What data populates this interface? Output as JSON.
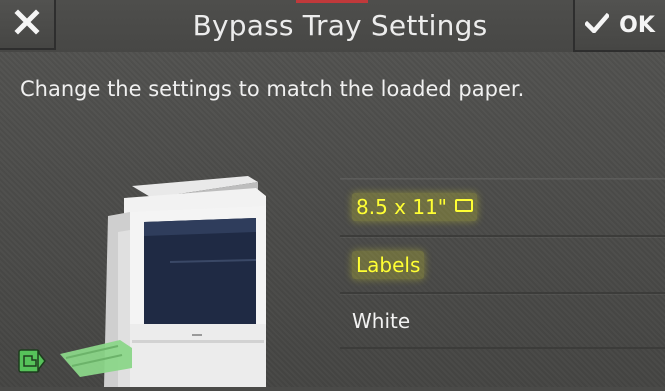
{
  "header": {
    "title": "Bypass Tray Settings",
    "close_icon": "close-icon",
    "ok_label": "OK",
    "ok_icon": "checkmark-icon"
  },
  "instruction": "Change the settings to match the loaded paper.",
  "settings": [
    {
      "label": "8.5 x 11\"",
      "icon": "paper-orientation-icon",
      "highlighted": true
    },
    {
      "label": "Labels",
      "highlighted": true
    },
    {
      "label": "White",
      "highlighted": false
    }
  ],
  "illustration": {
    "printer_icon": "printer-illustration",
    "tray_badge_icon": "bypass-tray-icon"
  },
  "colors": {
    "background": "#4a4a48",
    "highlight_text": "#ffff33",
    "accent_red": "#c0393b",
    "tray_green": "#7fcf7a"
  }
}
